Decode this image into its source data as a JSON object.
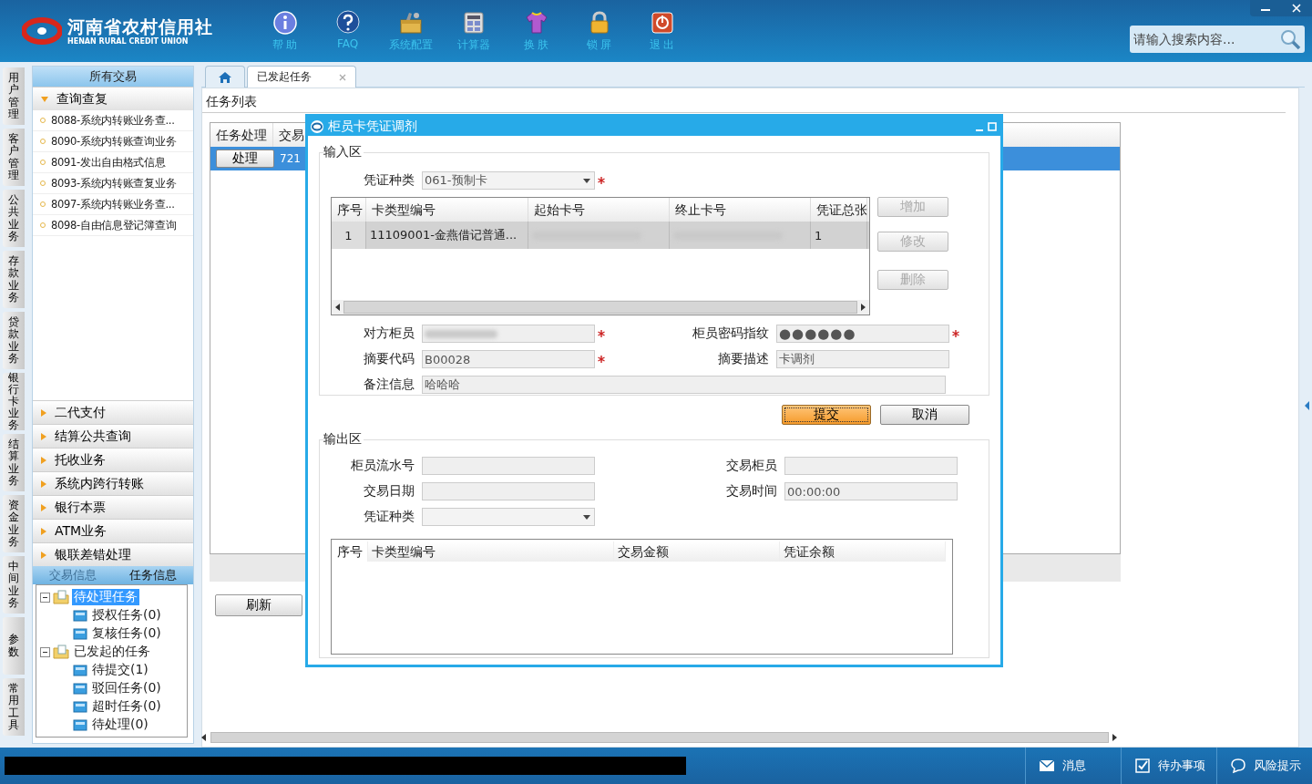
{
  "header": {
    "logo": {
      "name": "河南省农村信用社",
      "subtitle": "HENAN RURAL CREDIT UNION"
    },
    "toolbar": [
      {
        "label": "帮 助",
        "kind": "info"
      },
      {
        "label": "FAQ",
        "kind": "faq"
      },
      {
        "label": "系统配置",
        "kind": "config"
      },
      {
        "label": "计算器",
        "kind": "calculator"
      },
      {
        "label": "换 肤",
        "kind": "skin"
      },
      {
        "label": "锁 屏",
        "kind": "lock"
      },
      {
        "label": "退 出",
        "kind": "exit"
      }
    ],
    "search": {
      "placeholder": "请输入搜索内容..."
    }
  },
  "side_tabs": [
    {
      "label": "用户管理"
    },
    {
      "label": "客户管理"
    },
    {
      "label": "公共业务"
    },
    {
      "label": "存款业务"
    },
    {
      "label": "贷款业务"
    },
    {
      "label": "银行卡业务"
    },
    {
      "label": "结算业务"
    },
    {
      "label": "资金业务"
    },
    {
      "label": "中间业务"
    },
    {
      "label": "参数"
    },
    {
      "label": "常用工具"
    }
  ],
  "nav": {
    "title": "所有交易",
    "groups": [
      {
        "label": "查询查复",
        "expanded": true,
        "items": [
          "8088-系统内转账业务查...",
          "8090-系统内转账查询业务",
          "8091-发出自由格式信息",
          "8093-系统内转账查复业务",
          "8097-系统内转账业务查...",
          "8098-自由信息登记簿查询"
        ]
      },
      {
        "label": "二代支付",
        "expanded": false
      },
      {
        "label": "结算公共查询",
        "expanded": false
      },
      {
        "label": "托收业务",
        "expanded": false
      },
      {
        "label": "系统内跨行转账",
        "expanded": false
      },
      {
        "label": "银行本票",
        "expanded": false
      },
      {
        "label": "ATM业务",
        "expanded": false
      },
      {
        "label": "银联差错处理",
        "expanded": false
      }
    ],
    "info_tabs": [
      {
        "label": "交易信息",
        "selected": false
      },
      {
        "label": "任务信息",
        "selected": true
      }
    ],
    "tree": [
      {
        "label": "待处理任务",
        "selected": true,
        "expanded": true,
        "children": [
          {
            "label": "授权任务(0)",
            "selected": false
          },
          {
            "label": "复核任务(0)",
            "selected": false
          }
        ]
      },
      {
        "label": "已发起的任务",
        "selected": false,
        "expanded": true,
        "children": [
          {
            "label": "待提交(1)",
            "selected": false
          },
          {
            "label": "驳回任务(0)",
            "selected": false
          },
          {
            "label": "超时任务(0)",
            "selected": false
          },
          {
            "label": "待处理(0)",
            "selected": false
          }
        ]
      }
    ]
  },
  "content": {
    "tabs": [
      {
        "kind": "home",
        "selected": false
      },
      {
        "kind": "page",
        "label": "已发起任务",
        "selected": true
      }
    ],
    "section_title": "任务列表",
    "table": {
      "columns": [
        "任务处理",
        "交易"
      ],
      "rows": [
        {
          "action": "处理",
          "column_2": "721",
          "selected": true
        }
      ]
    },
    "refresh_button": "刷新"
  },
  "dialog": {
    "title": "柜员卡凭证调剂",
    "input_section": {
      "title": "输入区",
      "voucher_type": {
        "label": "凭证种类",
        "value": "061-预制卡",
        "required": true
      },
      "grid": {
        "columns": [
          "序号",
          "卡类型编号",
          "起始卡号",
          "终止卡号",
          "凭证总张"
        ],
        "rows": [
          {
            "cells": [
              {
                "text": "1"
              },
              {
                "text": "11109001-金燕借记普通..."
              },
              {
                "text": "",
                "blurred": true
              },
              {
                "text": "",
                "blurred": true
              },
              {
                "text": "1"
              }
            ]
          }
        ]
      },
      "side_buttons": [
        {
          "label": "增加",
          "disabled": true
        },
        {
          "label": "修改",
          "disabled": true
        },
        {
          "label": "删除",
          "disabled": true
        }
      ],
      "fields": [
        {
          "label": "对方柜员",
          "blurred": true,
          "required": true,
          "kind": "text"
        },
        {
          "label": "柜员密码指纹",
          "value": "●●●●●●",
          "required": true,
          "kind": "password"
        },
        {
          "label": "摘要代码",
          "value": "B00028",
          "required": true,
          "kind": "text"
        },
        {
          "label": "摘要描述",
          "value": "卡调剂",
          "required": false,
          "kind": "text"
        },
        {
          "label": "备注信息",
          "value": "哈哈哈",
          "required": false,
          "kind": "wide"
        }
      ]
    },
    "buttons": [
      {
        "label": "提交",
        "primary": true
      },
      {
        "label": "取消",
        "primary": false
      }
    ],
    "output_section": {
      "title": "输出区",
      "fields": [
        {
          "label": "柜员流水号",
          "kind": "text"
        },
        {
          "label": "交易柜员",
          "kind": "text"
        },
        {
          "label": "交易日期",
          "kind": "text"
        },
        {
          "label": "交易时间",
          "value": "00:00:00",
          "kind": "text"
        },
        {
          "label": "凭证种类",
          "kind": "select"
        }
      ],
      "grid": {
        "columns": [
          "序号",
          "卡类型编号",
          "交易金额",
          "凭证余额"
        ]
      }
    }
  },
  "status_bar": {
    "items": [
      {
        "label": "消息",
        "kind": "mail"
      },
      {
        "label": "待办事项",
        "kind": "todo"
      },
      {
        "label": "风险提示",
        "kind": "chat"
      }
    ]
  }
}
